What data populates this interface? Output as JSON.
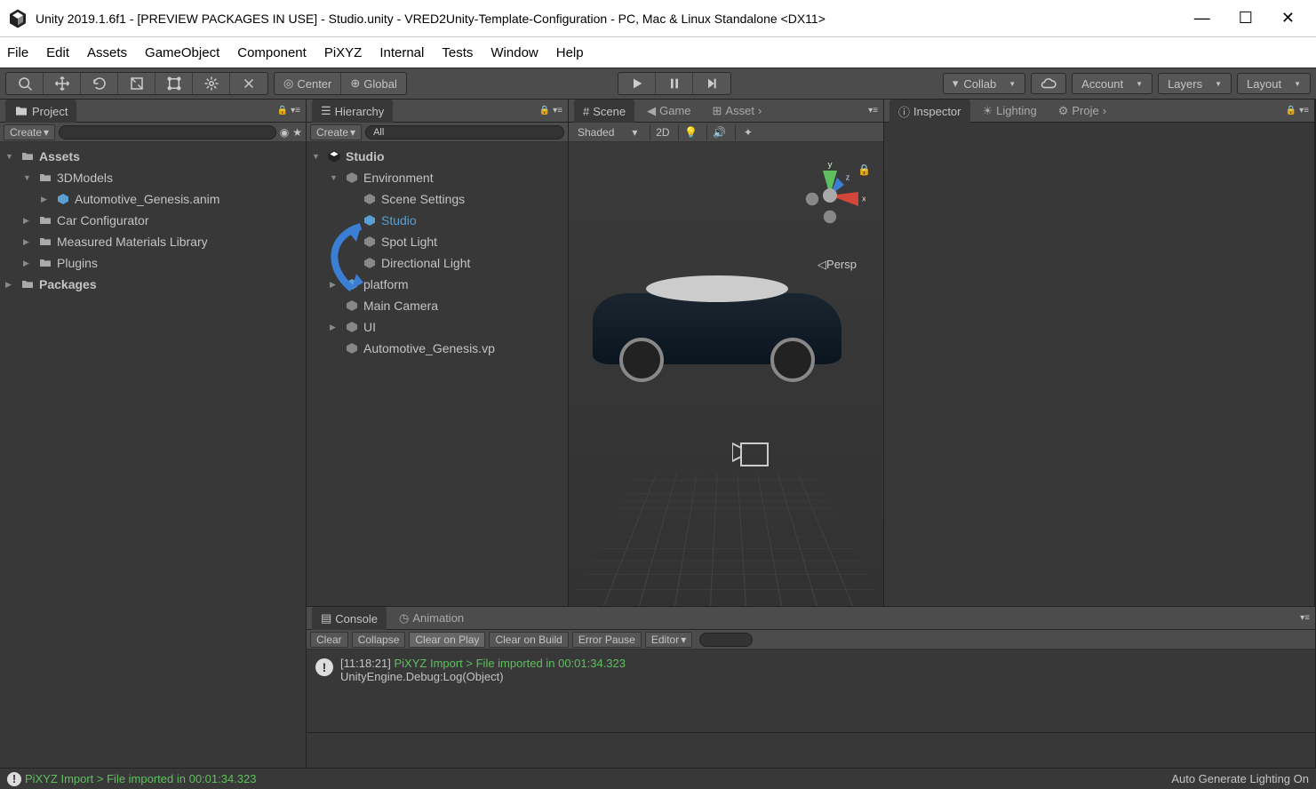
{
  "window": {
    "title": "Unity 2019.1.6f1 - [PREVIEW PACKAGES IN USE] - Studio.unity - VRED2Unity-Template-Configuration - PC, Mac & Linux Standalone <DX11>"
  },
  "menu": {
    "items": [
      "File",
      "Edit",
      "Assets",
      "GameObject",
      "Component",
      "PiXYZ",
      "Internal",
      "Tests",
      "Window",
      "Help"
    ]
  },
  "toolbar": {
    "center": "Center",
    "global": "Global",
    "collab": "Collab",
    "account": "Account",
    "layers": "Layers",
    "layout": "Layout"
  },
  "project": {
    "tab": "Project",
    "create": "Create",
    "tree": [
      {
        "lvl": 0,
        "fold": "▼",
        "type": "folder",
        "label": "Assets",
        "bold": true
      },
      {
        "lvl": 1,
        "fold": "▼",
        "type": "folder",
        "label": "3DModels"
      },
      {
        "lvl": 2,
        "fold": "▶",
        "type": "anim",
        "label": "Automotive_Genesis.anim"
      },
      {
        "lvl": 1,
        "fold": "▶",
        "type": "folder",
        "label": "Car Configurator"
      },
      {
        "lvl": 1,
        "fold": "▶",
        "type": "folder",
        "label": "Measured Materials Library"
      },
      {
        "lvl": 1,
        "fold": "▶",
        "type": "folder",
        "label": "Plugins"
      },
      {
        "lvl": 0,
        "fold": "▶",
        "type": "folder",
        "label": "Packages",
        "bold": true
      }
    ]
  },
  "hierarchy": {
    "tab": "Hierarchy",
    "create": "Create",
    "search": "All",
    "items": [
      {
        "lvl": 0,
        "fold": "▼",
        "type": "scene",
        "label": "Studio",
        "bold": true
      },
      {
        "lvl": 1,
        "fold": "▼",
        "type": "go",
        "label": "Environment"
      },
      {
        "lvl": 2,
        "fold": "",
        "type": "go",
        "label": "Scene Settings"
      },
      {
        "lvl": 2,
        "fold": "",
        "type": "prefab",
        "label": "Studio",
        "sel": true
      },
      {
        "lvl": 2,
        "fold": "",
        "type": "go",
        "label": "Spot Light"
      },
      {
        "lvl": 2,
        "fold": "",
        "type": "go",
        "label": "Directional Light"
      },
      {
        "lvl": 1,
        "fold": "▶",
        "type": "prefab",
        "label": "platform"
      },
      {
        "lvl": 1,
        "fold": "",
        "type": "go",
        "label": "Main Camera"
      },
      {
        "lvl": 1,
        "fold": "▶",
        "type": "go",
        "label": "UI"
      },
      {
        "lvl": 1,
        "fold": "",
        "type": "go",
        "label": "Automotive_Genesis.vp"
      }
    ]
  },
  "scene": {
    "scene_tab": "Scene",
    "game_tab": "Game",
    "asset_tab": "Asset",
    "shading": "Shaded",
    "mode2d": "2D",
    "persp": "Persp",
    "x": "x",
    "y": "y",
    "z": "z"
  },
  "inspector": {
    "inspector_tab": "Inspector",
    "lighting_tab": "Lighting",
    "project_tab": "Proje"
  },
  "console": {
    "console_tab": "Console",
    "animation_tab": "Animation",
    "clear": "Clear",
    "collapse": "Collapse",
    "clear_play": "Clear on Play",
    "clear_build": "Clear on Build",
    "error_pause": "Error Pause",
    "editor": "Editor",
    "log_time": "[11:18:21]",
    "log_msg": "PiXYZ Import > File imported in 00:01:34.323",
    "log_line2": "UnityEngine.Debug:Log(Object)"
  },
  "status": {
    "msg": "PiXYZ Import > File imported in 00:01:34.323",
    "lighting": "Auto Generate Lighting On"
  }
}
